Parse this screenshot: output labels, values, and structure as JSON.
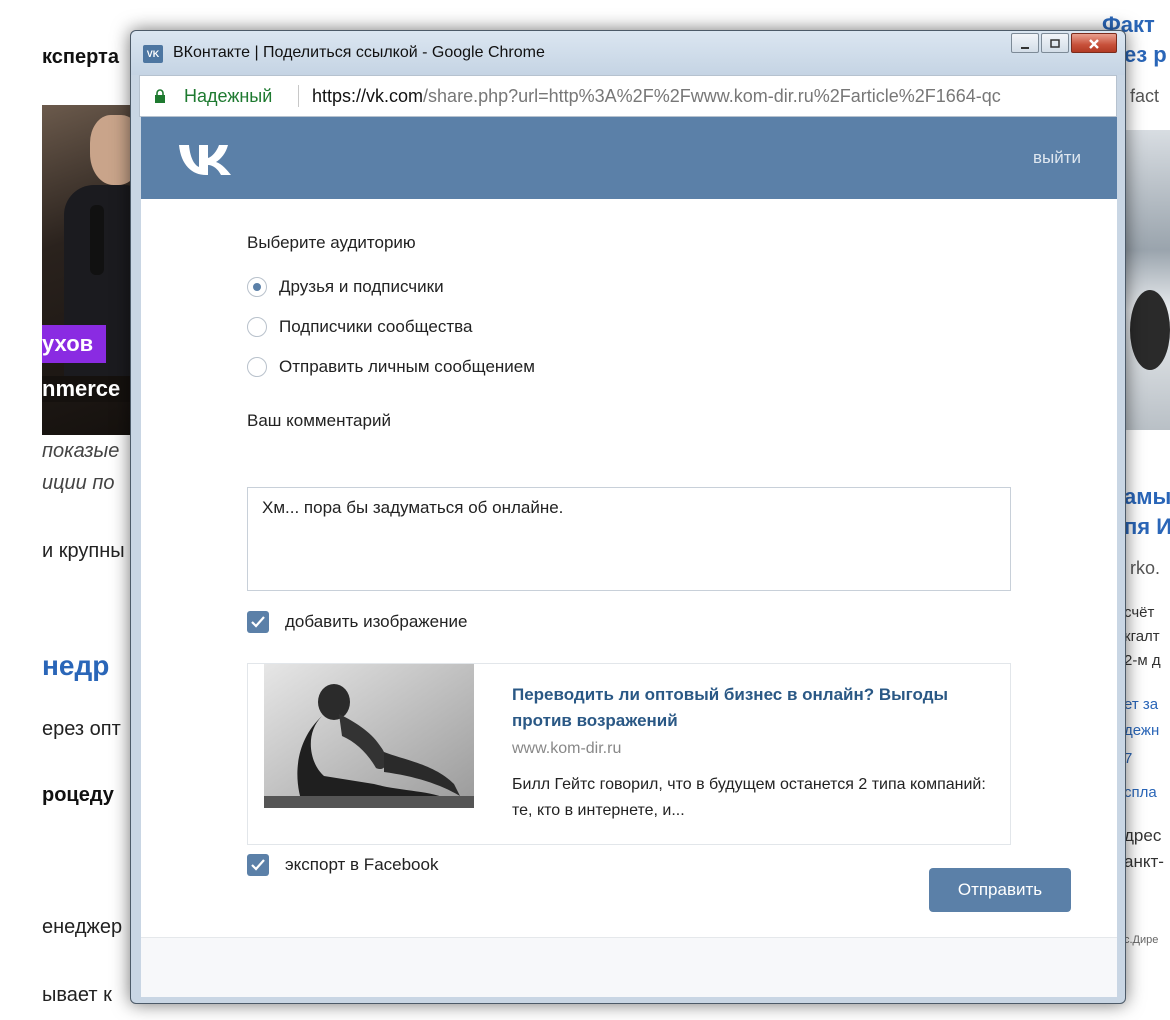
{
  "background": {
    "left_texts": [
      "кспертa",
      "ухов",
      "nmerce",
      "показые",
      "иции по",
      "и крупны",
      "недр",
      "ерез опт",
      "роцеду",
      "енеджер",
      "ывает к"
    ],
    "right_texts": [
      "Факт",
      "ез р",
      "fact",
      "амы",
      "пя И",
      "rko.",
      "счёт",
      "кгалт",
      "2-м д",
      "ет за",
      "дежн",
      "7",
      "спла",
      "дрес",
      "анкт-",
      "с.Дире"
    ]
  },
  "window": {
    "title": "ВКонтакте | Поделиться ссылкой - Google Chrome",
    "app_icon": "vk-icon",
    "controls": {
      "minimize": "minimize-icon",
      "maximize": "maximize-icon",
      "close": "close-icon"
    }
  },
  "addressbar": {
    "secure_label": "Надежный",
    "url_host": "https://vk.com",
    "url_rest": "/share.php?url=http%3A%2F%2Fwww.kom-dir.ru%2Farticle%2F1664-qc",
    "lock_icon": "lock-icon"
  },
  "vk": {
    "logo": "VK",
    "logout": "выйти",
    "accent": "#5b80a8"
  },
  "form": {
    "audience_title": "Выберите аудиторию",
    "audience_options": [
      {
        "label": "Друзья и подписчики",
        "checked": true
      },
      {
        "label": "Подписчики сообщества",
        "checked": false
      },
      {
        "label": "Отправить личным сообщением",
        "checked": false
      }
    ],
    "comment_title": "Ваш комментарий",
    "comment_value": "Хм... пора бы задуматься об онлайне.",
    "add_image_label": "добавить изображение",
    "add_image_checked": true,
    "export_label": "экспорт в Facebook",
    "export_checked": true,
    "send_label": "Отправить"
  },
  "preview": {
    "title": "Переводить ли оптовый бизнес в онлайн? Выгоды против возражений",
    "domain": "www.kom-dir.ru",
    "description": "Билл Гейтс говорил, что в будущем останется 2 типа компаний: те, кто в интернете, и..."
  }
}
